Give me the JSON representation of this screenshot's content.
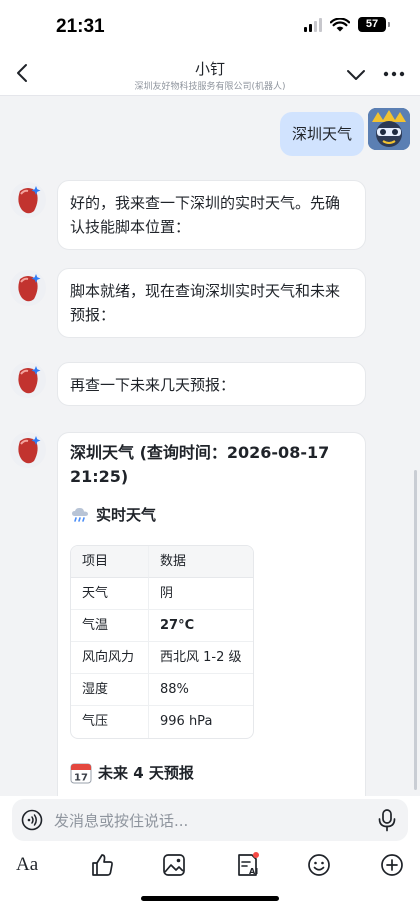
{
  "status_bar": {
    "time": "21:31",
    "battery": "57"
  },
  "header": {
    "title": "小钉",
    "subtitle": "深圳友好物科技服务有限公司(机器人)"
  },
  "messages": {
    "user_1": "深圳天气",
    "bot_1": "好的，我来查一下深圳的实时天气。先确认技能脚本位置：",
    "bot_2": "脚本就绪，现在查询深圳实时天气和未来预报：",
    "bot_3": "再查一下未来几天预报：",
    "card": {
      "title": "深圳天气 (查询时间：2026-08-17 21:25)",
      "realtime_title": "实时天气",
      "table_headers": [
        "项目",
        "数据"
      ],
      "rows": [
        [
          "天气",
          "阴"
        ],
        [
          "气温",
          "27°C"
        ],
        [
          "风向风力",
          "西北风 1-2 级"
        ],
        [
          "湿度",
          "88%"
        ],
        [
          "气压",
          "996 hPa"
        ]
      ],
      "forecast_title": "未来 4 天预报",
      "forecast_icon_text": "17"
    }
  },
  "input": {
    "placeholder": "发消息或按住说话..."
  },
  "toolbar": {
    "format_label": "Aa"
  },
  "colors": {
    "user_bubble": "#d1e3fe",
    "card_bg": "#ffffff",
    "notification_dot": "#f54a45"
  }
}
